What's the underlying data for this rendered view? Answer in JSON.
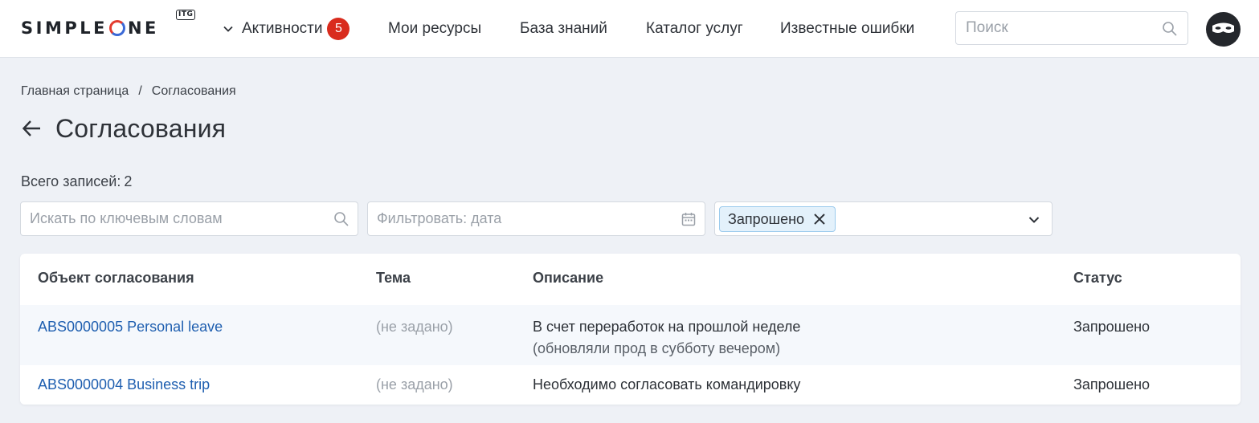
{
  "header": {
    "logo_text": "SIMPLEONE",
    "logo_badge": "ITG",
    "nav": {
      "activities_label": "Активности",
      "activities_count": "5",
      "resources_label": "Мои ресурсы",
      "knowledge_label": "База знаний",
      "catalog_label": "Каталог услуг",
      "errors_label": "Известные ошибки"
    },
    "search_placeholder": "Поиск"
  },
  "breadcrumb": {
    "home": "Главная страница",
    "separator": "/",
    "current": "Согласования"
  },
  "page_title": "Согласования",
  "total": {
    "label": "Всего записей:",
    "count": "2"
  },
  "filters": {
    "keyword_placeholder": "Искать по ключевым словам",
    "date_placeholder": "Фильтровать: дата",
    "status_chip": "Запрошено"
  },
  "table": {
    "columns": {
      "object": "Объект согласования",
      "theme": "Тема",
      "description": "Описание",
      "status": "Статус"
    },
    "rows": [
      {
        "object": "ABS0000005 Personal leave",
        "theme": "(не задано)",
        "description_line1": "В счет переработок на прошлой неделе",
        "description_line2": "(обновляли прод в субботу вечером)",
        "status": "Запрошено"
      },
      {
        "object": "ABS0000004 Business trip",
        "theme": "(не задано)",
        "description_line1": "Необходимо согласовать командировку",
        "status": "Запрошено"
      }
    ]
  },
  "colors": {
    "accent_link": "#1f5fb0",
    "badge": "#d92b1d",
    "chip_bg": "#e3f1fb",
    "logo_red": "#e33c2f",
    "logo_blue": "#3b69d6"
  },
  "icons": [
    "chevron-down-icon",
    "search-icon",
    "calendar-icon",
    "close-icon",
    "arrow-left-icon",
    "avatar-mask-icon"
  ]
}
